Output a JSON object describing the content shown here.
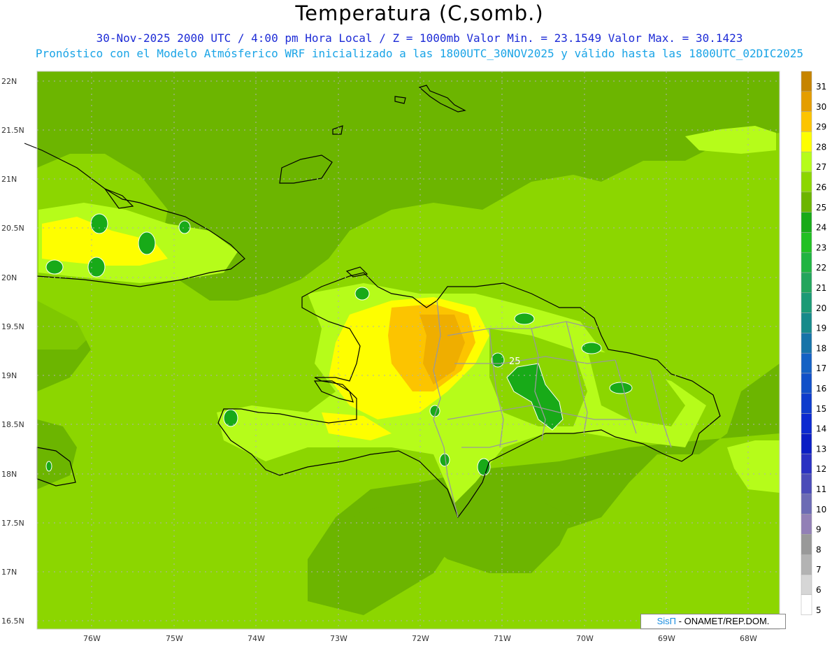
{
  "header": {
    "title": "Temperatura (C,somb.)",
    "line1_date": "30-Nov-2025 2000 UTC / 4:00 pm Hora Local / Z = 1000mb",
    "line1_min": "Valor Min. = 23.1549",
    "line1_max": "Valor Max. = 30.1423",
    "line2": "Pronóstico con el Modelo Atmósferico WRF inicializado a las 1800UTC_30NOV2025 y válido hasta las 1800UTC_02DIC2025"
  },
  "axes": {
    "lat_labels": [
      "22N",
      "21.5N",
      "21N",
      "20.5N",
      "20N",
      "19.5N",
      "19N",
      "18.5N",
      "18N",
      "17.5N",
      "17N",
      "16.5N"
    ],
    "lon_labels": [
      "76W",
      "75W",
      "74W",
      "73W",
      "72W",
      "71W",
      "70W",
      "69W",
      "68W"
    ]
  },
  "contour_label": "25",
  "colorbar": {
    "levels": [
      "31",
      "30",
      "29",
      "28",
      "27",
      "26",
      "25",
      "24",
      "23",
      "22",
      "21",
      "20",
      "19",
      "18",
      "17",
      "16",
      "15",
      "14",
      "13",
      "12",
      "11",
      "10",
      "9",
      "8",
      "7",
      "6",
      "5"
    ],
    "colors": [
      "#c68400",
      "#e49d00",
      "#fcc400",
      "#fefe00",
      "#b6fc1a",
      "#8cd600",
      "#6cb500",
      "#18aa18",
      "#21c022",
      "#20b441",
      "#23a55c",
      "#1c9a75",
      "#178a8a",
      "#1673a8",
      "#1461c4",
      "#1150c8",
      "#0e3ccc",
      "#0c2ad0",
      "#0b1ec4",
      "#2a31c2",
      "#4b4cb8",
      "#6c6bb4",
      "#9280b6",
      "#999",
      "#b3b3b3",
      "#d6d6d6",
      "#fff"
    ]
  },
  "credit": {
    "sis": "SisΠ",
    "rest": " - ONAMET/REP.DOM."
  }
}
